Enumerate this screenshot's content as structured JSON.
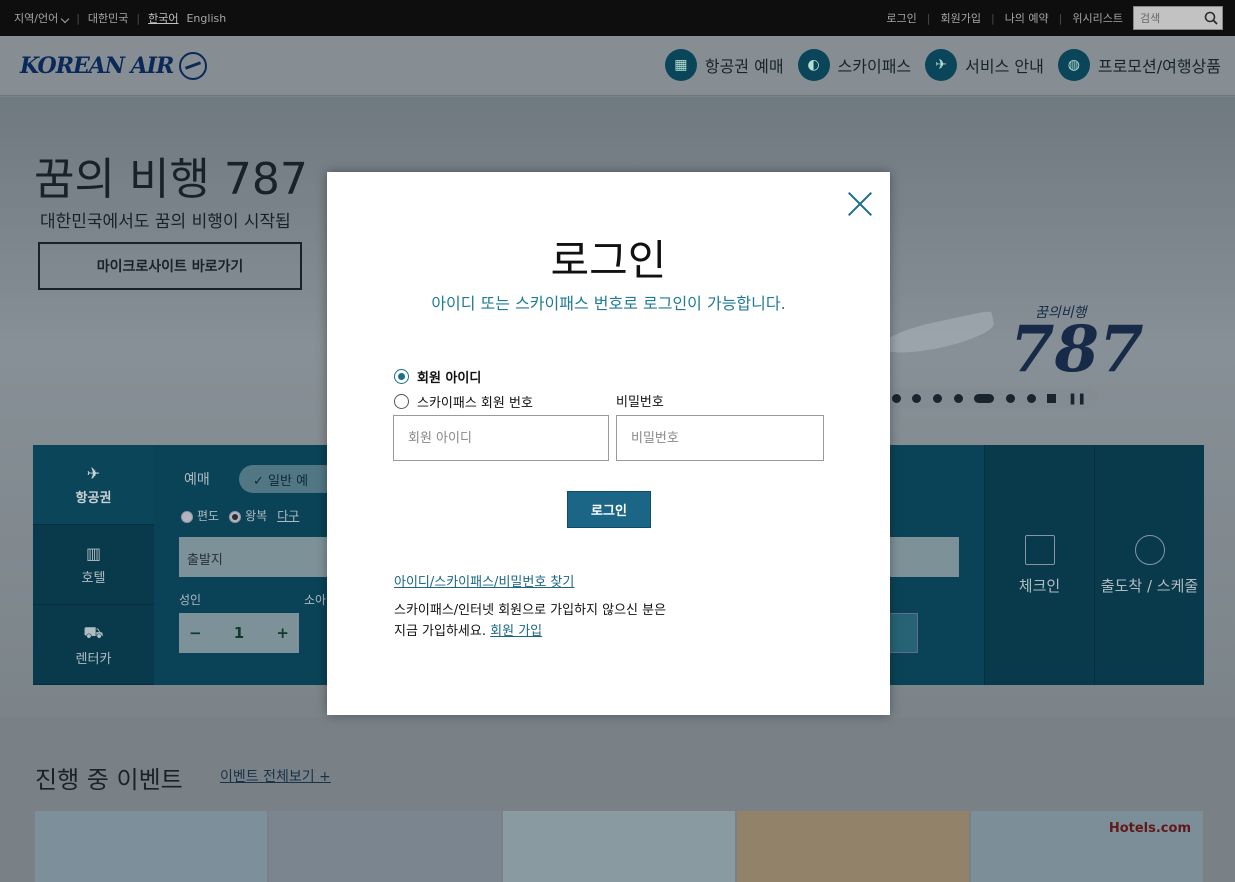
{
  "utilbar": {
    "region_label": "지역/언어",
    "country": "대한민국",
    "lang_ko": "한국어",
    "lang_en": "English",
    "login": "로그인",
    "signup": "회원가입",
    "my_reservation": "나의 예약",
    "wishlist": "위시리스트",
    "search_placeholder": "검색"
  },
  "header": {
    "logo_text": "KOREAN AIR",
    "nav": [
      {
        "label": "항공권 예매",
        "icon": "calendar-icon"
      },
      {
        "label": "스카이패스",
        "icon": "skypass-icon"
      },
      {
        "label": "서비스 안내",
        "icon": "airplane-icon"
      },
      {
        "label": "프로모션/여행상품",
        "icon": "globe-icon"
      }
    ]
  },
  "hero": {
    "title": "꿈의 비행 787",
    "subtitle": "대한민국에서도 꿈의 비행이 시작됩",
    "button": "마이크로사이트 바로가기",
    "badge_number": "787",
    "badge_caption": "꿈의비행"
  },
  "booking": {
    "tabs": [
      {
        "label": "항공권",
        "icon": "airplane-icon"
      },
      {
        "label": "호텔",
        "icon": "hotel-icon"
      },
      {
        "label": "렌터카",
        "icon": "car-icon"
      }
    ],
    "reservation_label": "예매",
    "normal_pill": "✓  일반 예",
    "trip_oneway": "편도",
    "trip_roundtrip": "왕복",
    "trip_multi": "다구",
    "origin_placeholder": "출발지",
    "adult_label": "성인",
    "child_label": "소아",
    "adult_count": "1",
    "minus": "−",
    "plus": "+",
    "checkin": "체크인",
    "arrivals": "출도착 / 스케줄"
  },
  "events": {
    "title": "진행 중 이벤트",
    "view_all": "이벤트 전체보기 +",
    "hotels_brand": "Hotels.com"
  },
  "modal": {
    "title": "로그인",
    "subtitle": "아이디 또는 스카이패스 번호로 로그인이 가능합니다.",
    "option_member_id": "회원 아이디",
    "option_skypass": "스카이패스 회원 번호",
    "password_label": "비밀번호",
    "id_placeholder": "회원 아이디",
    "password_placeholder": "비밀번호",
    "login_button": "로그인",
    "find_link": "아이디/스카이패스/비밀번호 찾기",
    "join_line1": "스카이패스/인터넷 회원으로 가입하지 않으신 분은",
    "join_line2": "지금 가입하세요.",
    "join_link": "회원 가입",
    "accent_color": "#1b6686"
  }
}
